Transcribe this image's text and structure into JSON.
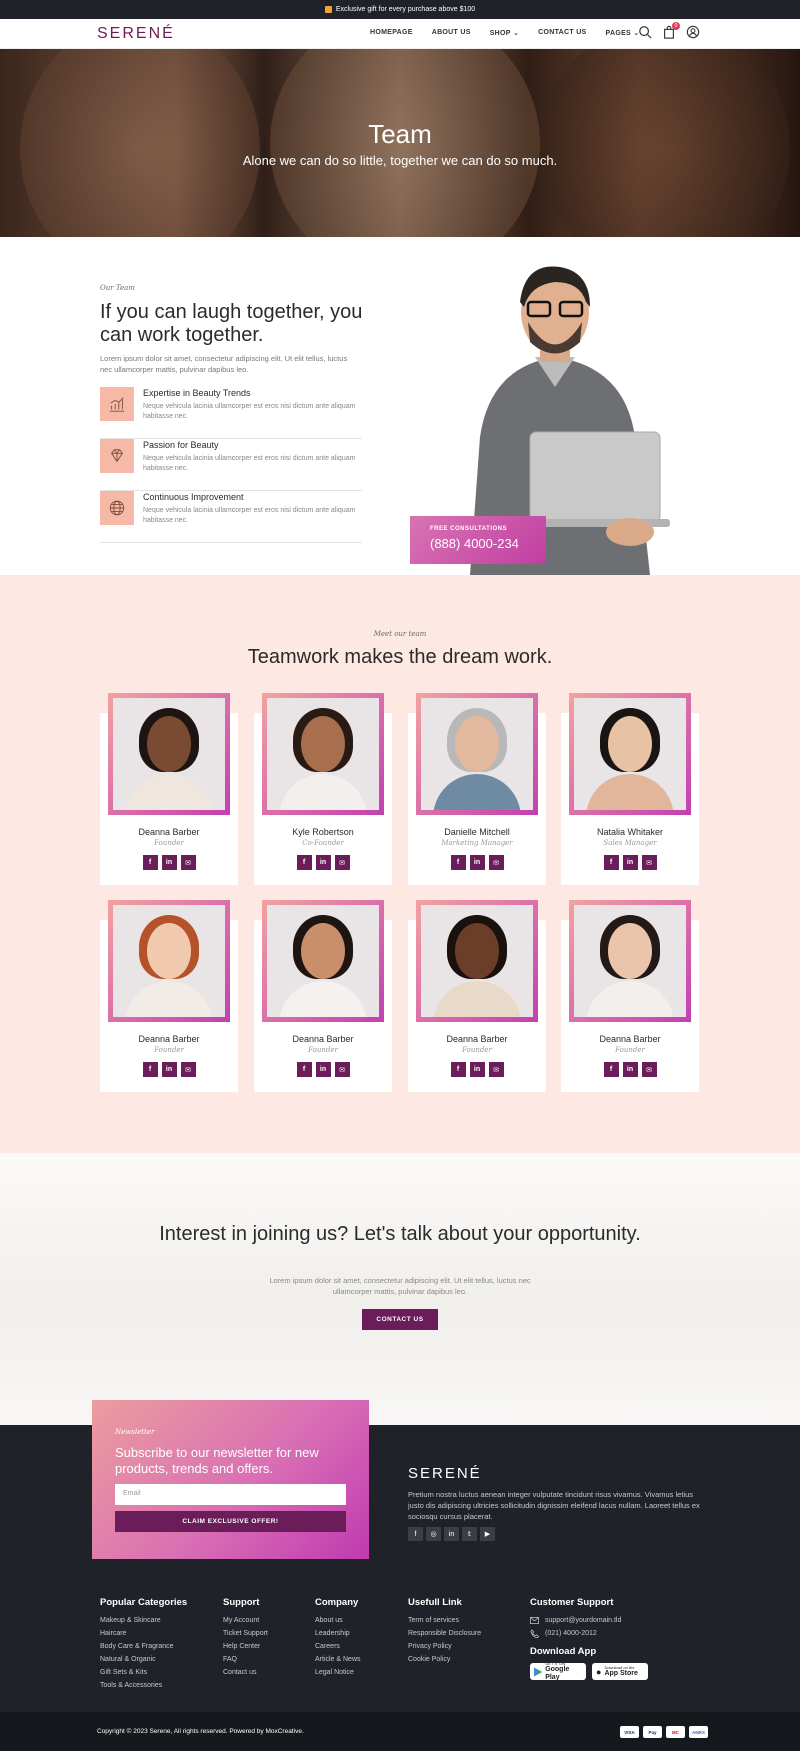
{
  "topbar": {
    "text": "Exclusive gift for every purchase above $100"
  },
  "header": {
    "logo": "SERENÉ",
    "menu": [
      "HOMEPAGE",
      "ABOUT US",
      "SHOP",
      "CONTACT US",
      "PAGES"
    ],
    "cart_count": "0"
  },
  "hero": {
    "title": "Team",
    "subtitle": "Alone we can do so little, together we can do so much."
  },
  "about": {
    "eyebrow": "Our Team",
    "title": "If you can laugh together, you can work together.",
    "lead": "Lorem ipsum dolor sit amet, consectetur adipiscing elit. Ut elit tellus, luctus nec ullamcorper mattis, pulvinar dapibus leo.",
    "features": [
      {
        "title": "Expertise in Beauty Trends",
        "text": "Neque vehicula lacinia ullamcorper est eros nisi dictum ante aliquam habitasse nec.",
        "icon": "chart-icon"
      },
      {
        "title": "Passion for Beauty",
        "text": "Neque vehicula lacinia ullamcorper est eros nisi dictum ante aliquam habitasse nec.",
        "icon": "diamond-icon"
      },
      {
        "title": "Continuous Improvement",
        "text": "Neque vehicula lacinia ullamcorper est eros nisi dictum ante aliquam habitasse nec.",
        "icon": "globe-icon"
      }
    ],
    "consult_label": "FREE CONSULTATIONS",
    "consult_phone": "(888) 4000-234"
  },
  "team": {
    "eyebrow": "Meet our team",
    "title": "Teamwork makes the dream work.",
    "members": [
      {
        "name": "Deanna Barber",
        "role": "Founder"
      },
      {
        "name": "Kyle Robertson",
        "role": "Co-Founder"
      },
      {
        "name": "Danielle Mitchell",
        "role": "Marketing Manager"
      },
      {
        "name": "Natalia Whitaker",
        "role": "Sales Manager"
      },
      {
        "name": "Deanna Barber",
        "role": "Founder"
      },
      {
        "name": "Deanna Barber",
        "role": "Founder"
      },
      {
        "name": "Deanna Barber",
        "role": "Founder"
      },
      {
        "name": "Deanna Barber",
        "role": "Founder"
      }
    ]
  },
  "join": {
    "title": "Interest in joining us? Let's talk about your opportunity.",
    "text": "Lorem ipsum dolor sit amet, consectetur adipiscing elit. Ut elit tellus, luctus nec ullamcorper mattis, pulvinar dapibus leo.",
    "button": "CONTACT US"
  },
  "newsletter": {
    "eyebrow": "Newsletter",
    "title": "Subscribe to our newsletter for new products, trends and offers.",
    "placeholder": "Email",
    "button": "CLAIM EXCLUSIVE OFFER!"
  },
  "footer": {
    "logo": "SERENÉ",
    "desc": "Pretium nostra luctus aenean integer vulputate tincidunt risus vivamus. Vivamus letius justo dis adipiscing ultricies sollicitudin dignissim eleifend lacus nullam. Laoreet tellus ex sociosqu cursus placerat.",
    "columns": [
      {
        "title": "Popular Categories",
        "items": [
          "Makeup & Skincare",
          "Haircare",
          "Body Care & Fragrance",
          "Natural & Organic",
          "Gift Sets & Kits",
          "Tools & Accessories"
        ]
      },
      {
        "title": "Support",
        "items": [
          "My Account",
          "Ticket Support",
          "Help Center",
          "FAQ",
          "Contact us"
        ]
      },
      {
        "title": "Company",
        "items": [
          "About us",
          "Leadership",
          "Careers",
          "Article & News",
          "Legal Notice"
        ]
      },
      {
        "title": "Usefull Link",
        "items": [
          "Term of services",
          "Responsible Disclosure",
          "Privacy Policy",
          "Cookie Policy"
        ]
      }
    ],
    "support_title": "Customer Support",
    "email": "support@yourdomain.tld",
    "phone": "(021) 4000-2012",
    "download_title": "Download App",
    "google_small": "GET IT ON",
    "google_big": "Google Play",
    "apple_small": "Download on the",
    "apple_big": "App Store",
    "copyright": "Copyright © 2023 Serene, All rights reserved. Powered by MoxCreative.",
    "payments": [
      "VISA",
      "Pay",
      "MC",
      "AMEX"
    ]
  }
}
